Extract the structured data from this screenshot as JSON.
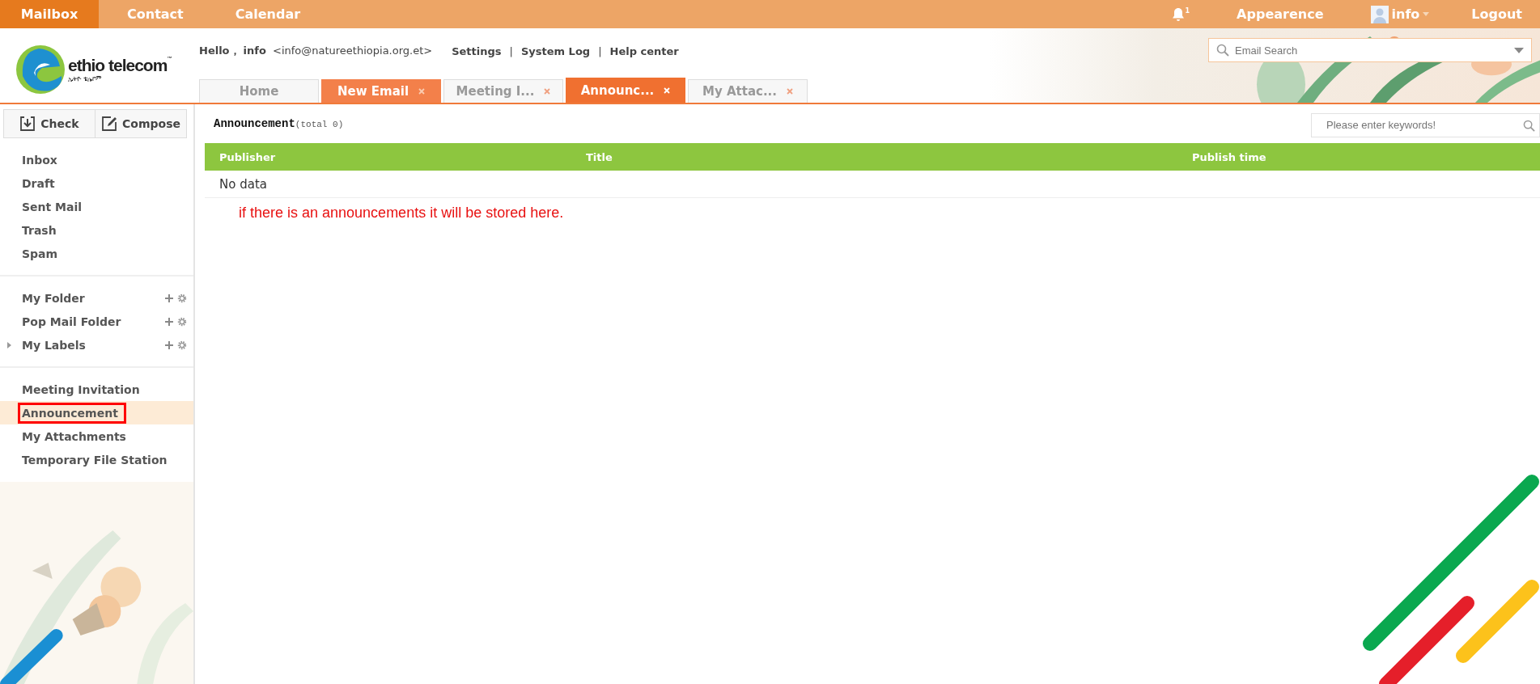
{
  "top_nav": {
    "items": [
      {
        "label": "Mailbox",
        "selected": true
      },
      {
        "label": "Contact",
        "selected": false
      },
      {
        "label": "Calendar",
        "selected": false
      }
    ],
    "notifications": "1",
    "appearance": "Appearence",
    "user": "info",
    "logout": "Logout"
  },
  "logo": {
    "name": "ethio telecom",
    "trademark": "™",
    "subtitle": "ኢትዮ ቴሌኮም"
  },
  "greeting": {
    "hello": "Hello，",
    "user": "info",
    "email": "<info@natureethiopia.org.et>",
    "links": [
      "Settings",
      "System Log",
      "Help center"
    ],
    "separator": "|"
  },
  "email_search": {
    "placeholder": "Email Search"
  },
  "tabs": [
    {
      "label": "Home",
      "selected": false,
      "closable": false
    },
    {
      "label": "New Email",
      "selected": false,
      "closable": true,
      "kind": "opened"
    },
    {
      "label": "Meeting I...",
      "selected": false,
      "closable": true
    },
    {
      "label": "Announc...",
      "selected": true,
      "closable": true
    },
    {
      "label": "My Attac...",
      "selected": false,
      "closable": true
    }
  ],
  "toolbar": {
    "buttons": [
      {
        "label": "Check",
        "kind": "check"
      },
      {
        "label": "Compose",
        "kind": "compose"
      }
    ]
  },
  "sidebar": {
    "groups": [
      [
        {
          "label": "Inbox",
          "selected": false
        },
        {
          "label": "Draft",
          "selected": false
        },
        {
          "label": "Sent Mail",
          "selected": false
        },
        {
          "label": "Trash",
          "selected": false
        },
        {
          "label": "Spam",
          "selected": false
        }
      ],
      [
        {
          "label": "My Folder",
          "selected": false,
          "tools": true
        },
        {
          "label": "Pop Mail Folder",
          "selected": false,
          "tools": true
        },
        {
          "label": "My Labels",
          "selected": false,
          "tools": true,
          "expanded": false
        }
      ],
      [
        {
          "label": "Meeting Invitation",
          "selected": false
        },
        {
          "label": "Announcement",
          "selected": true,
          "highlighted": true
        },
        {
          "label": "My Attachments",
          "selected": false
        },
        {
          "label": "Temporary File Station",
          "selected": false
        }
      ]
    ]
  },
  "content": {
    "title": "Announcement",
    "count": "(total 0)",
    "search": {
      "placeholder": "Please enter keywords!"
    },
    "table": {
      "columns": [
        "Publisher",
        "Title",
        "Publish time"
      ],
      "empty": "No data"
    },
    "annotation": "if there is an announcements it will be stored here."
  }
}
